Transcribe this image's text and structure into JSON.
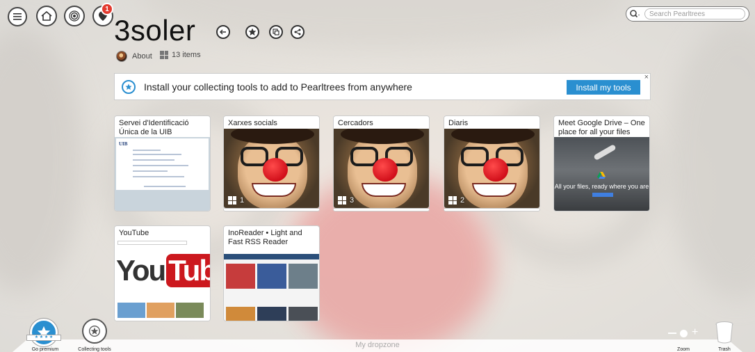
{
  "header": {
    "title": "3soler",
    "notification_count": "1",
    "about_label": "About",
    "items_label": "13 items"
  },
  "search": {
    "placeholder": "Search Pearltrees"
  },
  "banner": {
    "text": "Install your collecting tools to add to Pearltrees from anywhere",
    "button_label": "Install my tools",
    "close": "×"
  },
  "cards": [
    {
      "title": "Servei d'Identificació Única de la UIB",
      "thumb": "uib-screenshot",
      "count": ""
    },
    {
      "title": "Xarxes socials",
      "thumb": "photo",
      "count": "1"
    },
    {
      "title": "Cercadors",
      "thumb": "photo",
      "count": "3"
    },
    {
      "title": "Diaris",
      "thumb": "photo",
      "count": "2"
    },
    {
      "title": "Meet Google Drive – One place for all your files",
      "thumb": "drive",
      "count": "",
      "thumb_text": "All your files, ready where you are"
    },
    {
      "title": "YouTube",
      "thumb": "youtube",
      "count": "",
      "logo_you": "You",
      "logo_tube": "Tube"
    },
    {
      "title": "InoReader • Light and Fast RSS Reader",
      "thumb": "inoreader",
      "count": ""
    }
  ],
  "thumb_texts": {
    "uib_logo": "UIB"
  },
  "bottom": {
    "dropzone_label": "My dropzone",
    "premium_label": "Go premium",
    "collecting_label": "Collecting tools",
    "zoom_label": "Zoom",
    "trash_label": "Trash"
  },
  "colors": {
    "accent": "#2a8fd0",
    "badge": "#e23a2f",
    "youtube_red": "#cc181e"
  }
}
